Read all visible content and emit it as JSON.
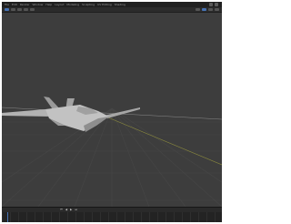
{
  "menubar": {
    "items": [
      "File",
      "Edit",
      "Render",
      "Window",
      "Help",
      "Layout",
      "Modeling",
      "Sculpting",
      "UV Editing",
      "Shading"
    ]
  },
  "header": {
    "left_icons": [
      "editor-type-icon",
      "view-menu-icon",
      "select-menu-icon",
      "add-menu-icon",
      "object-menu-icon"
    ],
    "right_icons": [
      "shading-wireframe-icon",
      "shading-solid-icon",
      "shading-material-icon",
      "shading-rendered-icon"
    ]
  },
  "timeline": {
    "controls": [
      "⏮",
      "◀",
      "▶",
      "⏭"
    ]
  },
  "colors": {
    "viewport_bg": "#3d3d3d",
    "grid": "#484848",
    "x_axis": "#8b8a3e",
    "y_axis": "#8a8a8a",
    "aircraft_light": "#c6c6c6",
    "aircraft_mid": "#a8a8a8",
    "aircraft_dark": "#8a8a8a"
  }
}
